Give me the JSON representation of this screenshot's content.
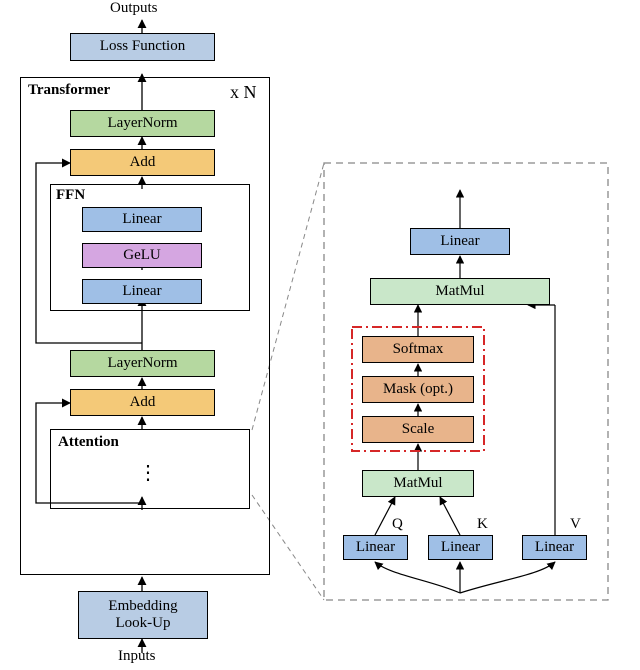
{
  "labels": {
    "outputs": "Outputs",
    "inputs": "Inputs",
    "transformer": "Transformer",
    "xn": "x N",
    "ffn": "FFN",
    "attention": "Attention",
    "q": "Q",
    "k": "K",
    "v": "V"
  },
  "main": {
    "loss": "Loss Function",
    "ln1": "LayerNorm",
    "add1": "Add",
    "linear_top": "Linear",
    "gelu": "GeLU",
    "linear_bot": "Linear",
    "ln2": "LayerNorm",
    "add2": "Add",
    "dots": "⋮",
    "embed": "Embedding\nLook-Up"
  },
  "attn": {
    "out_linear": "Linear",
    "matmul2": "MatMul",
    "softmax": "Softmax",
    "mask": "Mask (opt.)",
    "scale": "Scale",
    "matmul1": "MatMul",
    "linQ": "Linear",
    "linK": "Linear",
    "linV": "Linear"
  }
}
